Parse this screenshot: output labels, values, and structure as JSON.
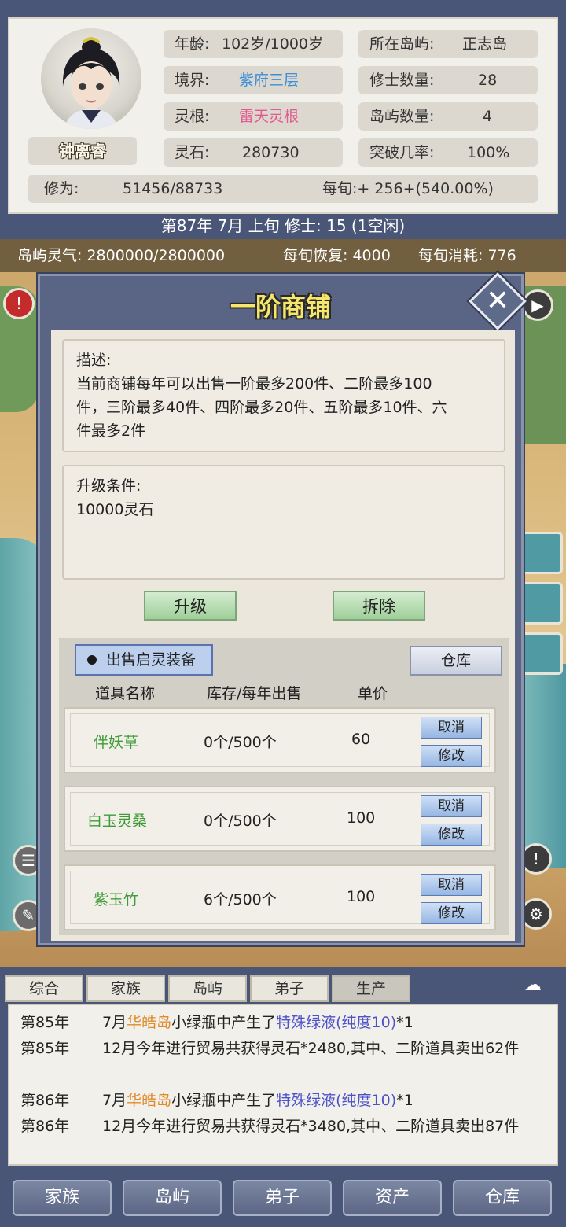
{
  "character": {
    "name": "钟离睿",
    "age_label": "年龄:",
    "age_value": "102岁/1000岁",
    "realm_label": "境界:",
    "realm_value": "紫府三层",
    "root_label": "灵根:",
    "root_value": "雷天灵根",
    "stones_label": "灵石:",
    "stones_value": "280730",
    "island_label": "所在岛屿:",
    "island_value": "正志岛",
    "cultivators_label": "修士数量:",
    "cultivators_value": "28",
    "islands_label": "岛屿数量:",
    "islands_value": "4",
    "breakthrough_label": "突破几率:",
    "breakthrough_value": "100%",
    "cultivation_label": "修为:",
    "cultivation_value": "51456/88733",
    "per_period": "每旬:+ 256+(540.00%)"
  },
  "status_line": "第87年 7月 上旬   修士: 15 (1空闲)",
  "map_bar": {
    "qi": "岛屿灵气: 2800000/2800000",
    "recover": "每旬恢复: 4000",
    "consume": "每旬消耗: 776"
  },
  "modal": {
    "title": "一阶商铺",
    "close_glyph": "✕",
    "desc_heading": "描述:",
    "desc_text": "当前商铺每年可以出售一阶最多200件、二阶最多100件，三阶最多40件、四阶最多20件、五阶最多10件、六件最多2件",
    "upgrade_heading": "升级条件:",
    "upgrade_text": "10000灵石",
    "upgrade_button": "升级",
    "demolish_button": "拆除",
    "sell_toggle": "出售启灵装备",
    "warehouse_button": "仓库",
    "columns": [
      "道具名称",
      "库存/每年出售",
      "单价"
    ],
    "rows": [
      {
        "name": "伴妖草",
        "stock": "0个/500个",
        "price": "60",
        "cancel": "取消",
        "edit": "修改"
      },
      {
        "name": "白玉灵桑",
        "stock": "0个/500个",
        "price": "100",
        "cancel": "取消",
        "edit": "修改"
      },
      {
        "name": "紫玉竹",
        "stock": "6个/500个",
        "price": "100",
        "cancel": "取消",
        "edit": "修改"
      }
    ]
  },
  "log_tabs": [
    "综合",
    "家族",
    "岛屿",
    "弟子",
    "生产"
  ],
  "log_active_tab": "生产",
  "log": [
    {
      "year": "第85年",
      "pre": "7月",
      "hl1": "华皓岛",
      "mid": "小绿瓶中产生了",
      "hl2": "特殊绿液(纯度10)",
      "post": "*1"
    },
    {
      "year": "第85年",
      "text": "12月今年进行贸易共获得灵石*2480,其中、二阶道具卖出62件"
    },
    {
      "year": "第86年",
      "pre": "7月",
      "hl1": "华皓岛",
      "mid": "小绿瓶中产生了",
      "hl2": "特殊绿液(纯度10)",
      "post": "*1"
    },
    {
      "year": "第86年",
      "text": "12月今年进行贸易共获得灵石*3480,其中、二阶道具卖出87件"
    }
  ],
  "nav": [
    "家族",
    "岛屿",
    "弟子",
    "资产",
    "仓库"
  ],
  "icons": {
    "play": "play-icon",
    "alert": "alert-icon",
    "gear": "gear-icon",
    "mascot": "mascot-icon"
  },
  "colors": {
    "realm": "#3c8ed6",
    "root": "#e25a8f",
    "item_name": "#3f9b38",
    "island_highlight": "#e08a2a",
    "item_highlight": "#4e52c9",
    "title": "#f6e66a"
  }
}
